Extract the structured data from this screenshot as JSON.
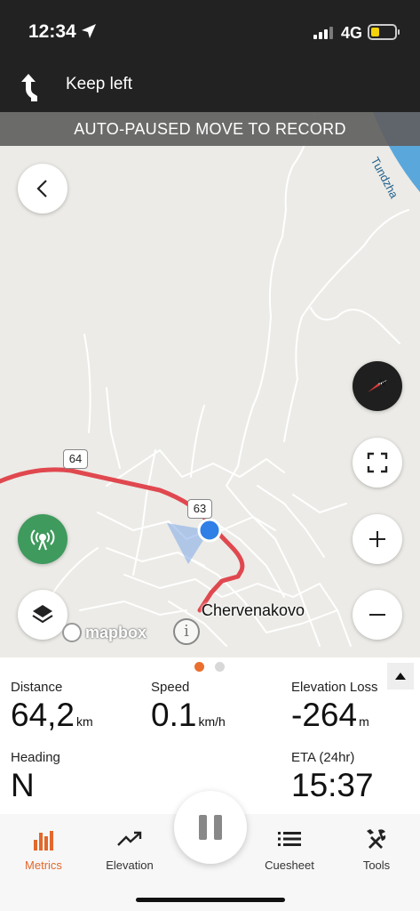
{
  "status_bar": {
    "time": "12:34",
    "network": "4G",
    "icons": [
      "location-arrow-icon",
      "signal-icon",
      "battery-icon"
    ]
  },
  "navigation": {
    "instruction": "Keep left",
    "icon": "turn-left-arrow-icon"
  },
  "map": {
    "banner": "AUTO-PAUSED MOVE TO RECORD",
    "road_shields": [
      "64",
      "63"
    ],
    "place_label": "Chervenakovo",
    "river_label": "Tundzha",
    "attribution": "mapbox",
    "info_symbol": "i",
    "route_color": "#e0484f",
    "location_color": "#2f7fe6"
  },
  "metrics": {
    "distance": {
      "label": "Distance",
      "value": "64,2",
      "unit": "km"
    },
    "speed": {
      "label": "Speed",
      "value": "0.1",
      "unit": "km/h"
    },
    "elevation_loss": {
      "label": "Elevation Loss",
      "value": "-264",
      "unit": "m"
    },
    "heading": {
      "label": "Heading",
      "value": "N"
    },
    "eta": {
      "label": "ETA (24hr)",
      "value": "15:37"
    },
    "page_count": 2,
    "active_page": 1
  },
  "tabs": [
    {
      "label": "Metrics",
      "icon": "bar-chart-icon",
      "active": true
    },
    {
      "label": "Elevation",
      "icon": "trend-up-icon",
      "active": false
    },
    {
      "label": "Cuesheet",
      "icon": "list-icon",
      "active": false
    },
    {
      "label": "Tools",
      "icon": "tools-icon",
      "active": false
    }
  ],
  "colors": {
    "accent": "#e2682b",
    "beacon": "#3f9a5d",
    "dark_bar": "#222222"
  }
}
